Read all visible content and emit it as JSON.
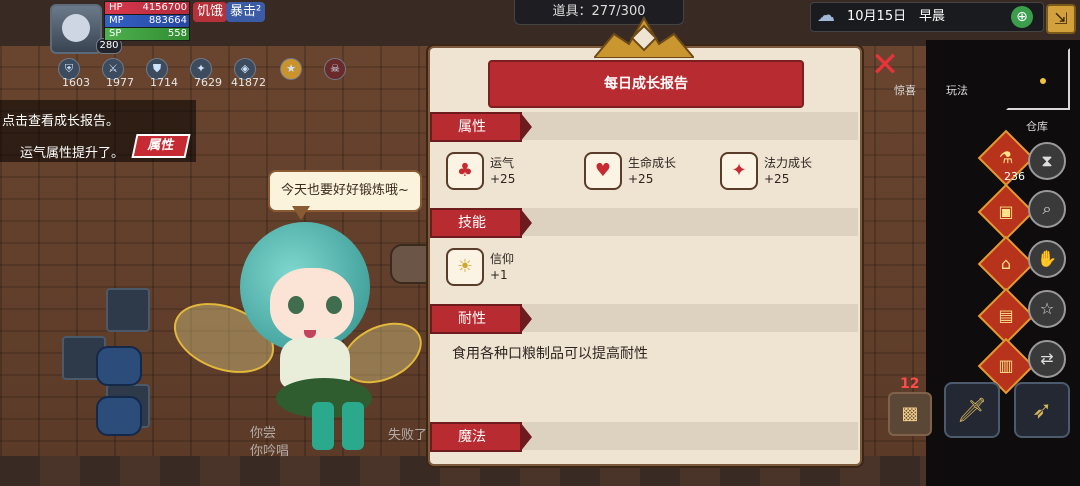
{
  "player": {
    "hp_label": "HP",
    "hp": "4156700",
    "mp_label": "MP",
    "mp": "883664",
    "sp_label": "SP",
    "sp": "558",
    "level": "280",
    "status_hungry": "饥饿",
    "status_crit": "暴击²"
  },
  "stats": [
    {
      "icon": "shield-icon",
      "value": "1603"
    },
    {
      "icon": "sword-icon",
      "value": "1977"
    },
    {
      "icon": "armor-icon",
      "value": "1714"
    },
    {
      "icon": "wand-icon",
      "value": "7629"
    },
    {
      "icon": "orb-icon",
      "value": "41872"
    },
    {
      "icon": "buff-icon",
      "value": ""
    },
    {
      "icon": "skull-icon",
      "value": ""
    }
  ],
  "messages": {
    "line1": "点击查看成长报告。",
    "line2": "运气属性提升了。",
    "tag": "属性"
  },
  "topbar": {
    "items": "道具：277/300",
    "date": "10月15日",
    "time": "早晨"
  },
  "side": {
    "surprise": "惊喜",
    "play": "玩法",
    "warehouse": "仓库",
    "potion_count": "236",
    "slot_numbers": "12"
  },
  "fairy": {
    "speech": "今天也要好好锻炼哦~"
  },
  "chat": {
    "ghost1": "你尝",
    "ghost2": "你吟唱",
    "ghost3": "失败了"
  },
  "report": {
    "title": "每日成长报告",
    "sections": {
      "attributes": "属性",
      "skills": "技能",
      "durability": "耐性",
      "magic": "魔法"
    },
    "attributes": [
      {
        "name": "运气",
        "value": "+25",
        "icon": "clover-icon"
      },
      {
        "name": "生命成长",
        "value": "+25",
        "icon": "heart-icon"
      },
      {
        "name": "法力成长",
        "value": "+25",
        "icon": "magic-icon"
      }
    ],
    "skills": [
      {
        "name": "信仰",
        "value": "+1",
        "icon": "faith-icon"
      }
    ],
    "durability_text": "食用各种口粮制品可以提高耐性"
  },
  "colors": {
    "accent_red": "#b82b30",
    "panel_bg": "#efe4d2",
    "gold": "#d6b35d"
  }
}
